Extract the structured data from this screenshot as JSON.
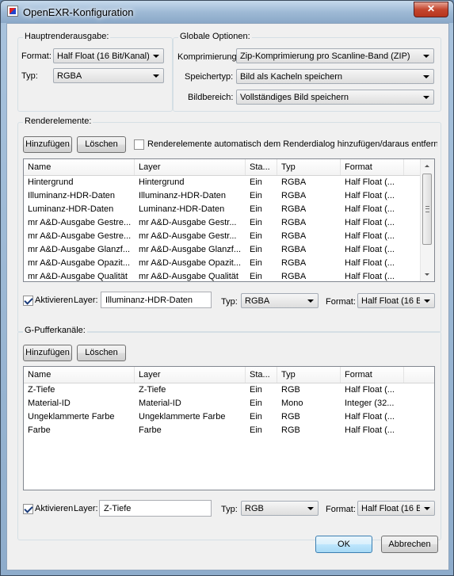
{
  "window": {
    "title": "OpenEXR-Konfiguration",
    "close_label": "✕"
  },
  "haupt": {
    "title": "Hauptrenderausgabe:",
    "format_label": "Format:",
    "format_value": "Half Float (16 Bit/Kanal)",
    "typ_label": "Typ:",
    "typ_value": "RGBA"
  },
  "global": {
    "title": "Globale Optionen:",
    "kompr_label": "Komprimierung:",
    "kompr_value": "Zip-Komprimierung pro Scanline-Band (ZIP)",
    "speicher_label": "Speichertyp:",
    "speicher_value": "Bild als Kacheln speichern",
    "bild_label": "Bildbereich:",
    "bild_value": "Vollständiges Bild speichern"
  },
  "render": {
    "title": "Renderelemente:",
    "add_label": "Hinzufügen",
    "delete_label": "Löschen",
    "auto_label": "Renderelemente automatisch dem Renderdialog hinzufügen/daraus entferne",
    "columns": [
      "Name",
      "Layer",
      "Sta...",
      "Typ",
      "Format"
    ],
    "rows": [
      [
        "Hintergrund",
        "Hintergrund",
        "Ein",
        "RGBA",
        "Half Float (..."
      ],
      [
        "Illuminanz-HDR-Daten",
        "Illuminanz-HDR-Daten",
        "Ein",
        "RGBA",
        "Half Float (..."
      ],
      [
        "Luminanz-HDR-Daten",
        "Luminanz-HDR-Daten",
        "Ein",
        "RGBA",
        "Half Float (..."
      ],
      [
        "mr A&D-Ausgabe Gestre...",
        "mr A&D-Ausgabe Gestr...",
        "Ein",
        "RGBA",
        "Half Float (..."
      ],
      [
        "mr A&D-Ausgabe Gestre...",
        "mr A&D-Ausgabe Gestr...",
        "Ein",
        "RGBA",
        "Half Float (..."
      ],
      [
        "mr A&D-Ausgabe Glanzf...",
        "mr A&D-Ausgabe Glanzf...",
        "Ein",
        "RGBA",
        "Half Float (..."
      ],
      [
        "mr A&D-Ausgabe Opazit...",
        "mr A&D-Ausgabe Opazit...",
        "Ein",
        "RGBA",
        "Half Float (..."
      ],
      [
        "mr A&D-Ausgabe Qualität",
        "mr A&D-Ausgabe Qualität",
        "Ein",
        "RGBA",
        "Half Float (..."
      ]
    ],
    "enable_label": "Aktivieren",
    "layer_label": "Layer:",
    "layer_value": "Illuminanz-HDR-Daten",
    "typ_label": "Typ:",
    "typ_value": "RGBA",
    "format_label": "Format:",
    "format_value": "Half Float (16 B"
  },
  "gbuffer": {
    "title": "G-Pufferkanäle:",
    "add_label": "Hinzufügen",
    "delete_label": "Löschen",
    "columns": [
      "Name",
      "Layer",
      "Sta...",
      "Typ",
      "Format"
    ],
    "rows": [
      [
        "Z-Tiefe",
        "Z-Tiefe",
        "Ein",
        "RGB",
        "Half Float (..."
      ],
      [
        "Material-ID",
        "Material-ID",
        "Ein",
        "Mono",
        "Integer (32..."
      ],
      [
        "Ungeklammerte Farbe",
        "Ungeklammerte Farbe",
        "Ein",
        "RGB",
        "Half Float (..."
      ],
      [
        "Farbe",
        "Farbe",
        "Ein",
        "RGB",
        "Half Float (..."
      ]
    ],
    "enable_label": "Aktivieren",
    "layer_label": "Layer:",
    "layer_value": "Z-Tiefe",
    "typ_label": "Typ:",
    "typ_value": "RGB",
    "format_label": "Format:",
    "format_value": "Half Float (16 B"
  },
  "footer": {
    "ok_label": "OK",
    "cancel_label": "Abbrechen"
  }
}
